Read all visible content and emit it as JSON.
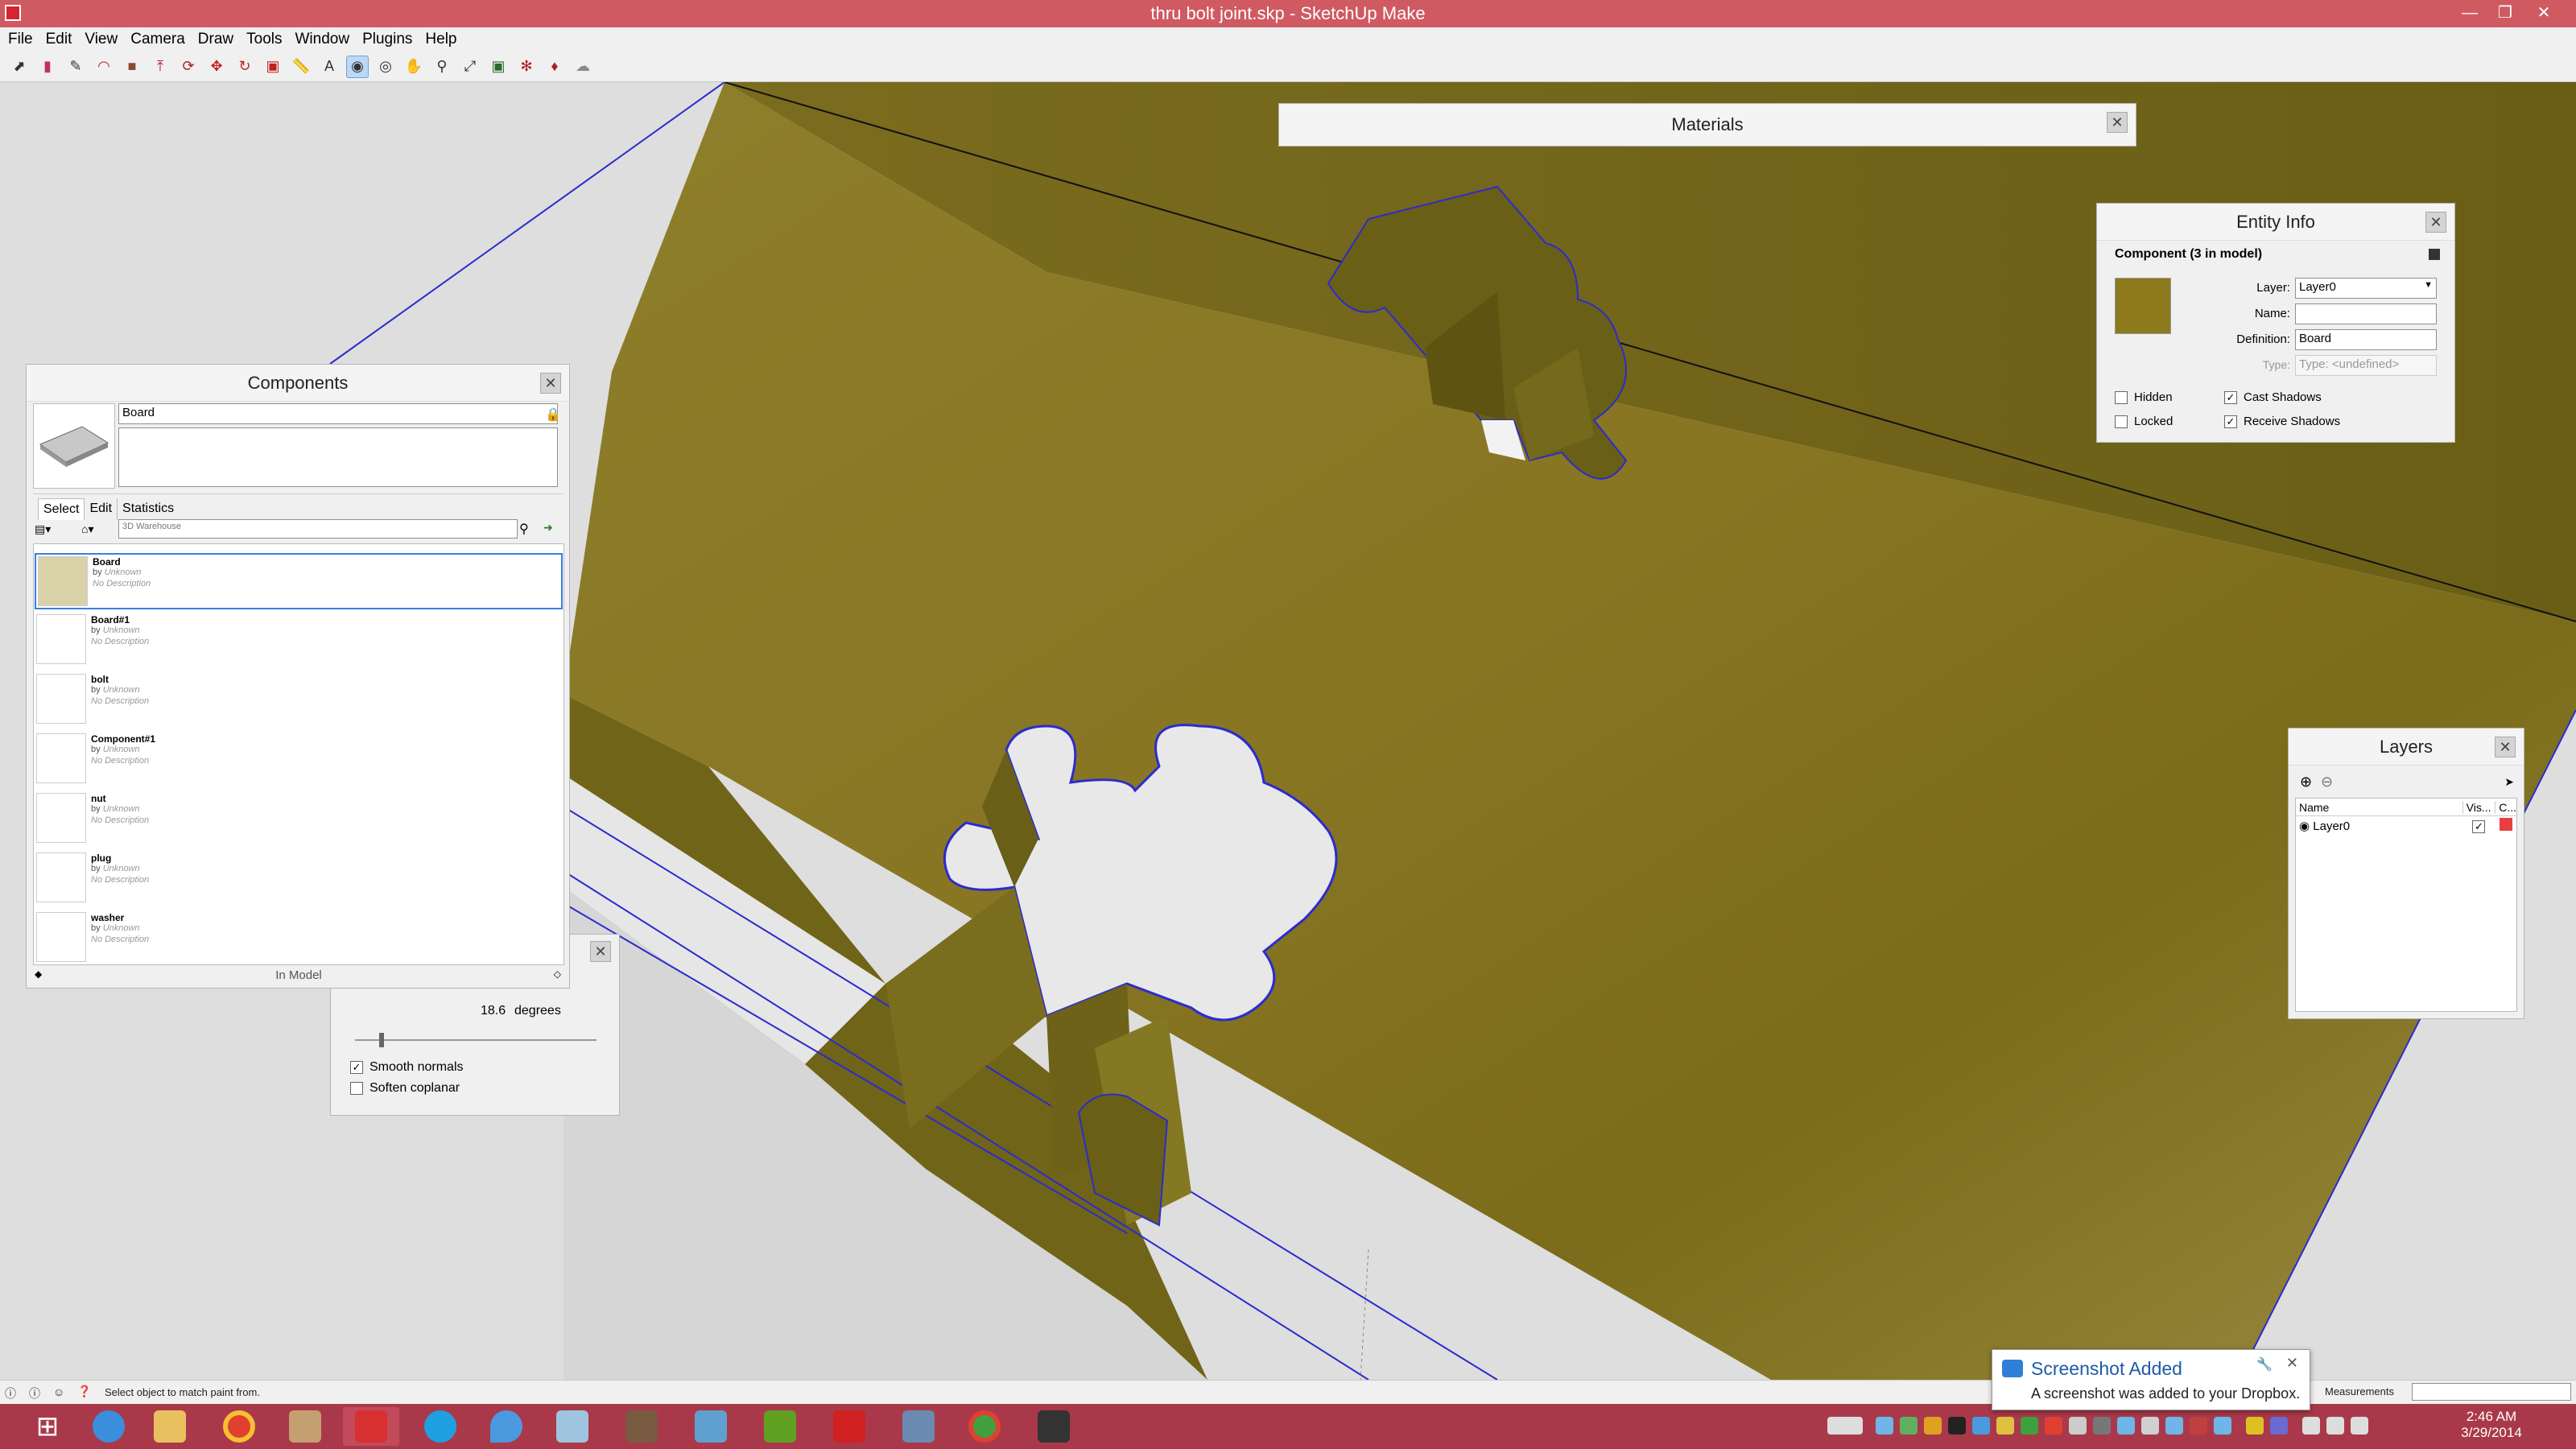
{
  "window": {
    "title": "thru bolt joint.skp - SketchUp Make",
    "controls": [
      "minimize",
      "restore",
      "close"
    ]
  },
  "menu": [
    "File",
    "Edit",
    "View",
    "Camera",
    "Draw",
    "Tools",
    "Window",
    "Plugins",
    "Help"
  ],
  "toolbar_icons": [
    "select-icon",
    "eraser-icon",
    "pencil-icon",
    "arc-icon",
    "rectangle-icon",
    "pushpull-icon",
    "followme-icon",
    "move-icon",
    "rotate-icon",
    "scale-icon",
    "tape-icon",
    "text-icon",
    "paint-icon",
    "orbit-icon",
    "pan-icon",
    "zoom-icon",
    "zoom-extents-icon",
    "warehouse-icon",
    "extension-icon",
    "ruby-icon",
    "sandbox-icon"
  ],
  "toolbar_active_index": 12,
  "materials": {
    "title": "Materials"
  },
  "entity_info": {
    "title": "Entity Info",
    "heading": "Component (3 in model)",
    "layer_label": "Layer:",
    "layer_value": "Layer0",
    "name_label": "Name:",
    "name_value": "",
    "definition_label": "Definition:",
    "definition_value": "Board",
    "type_label": "Type:",
    "type_value": "Type: <undefined>",
    "hidden_label": "Hidden",
    "hidden_checked": false,
    "locked_label": "Locked",
    "locked_checked": false,
    "cast_label": "Cast Shadows",
    "cast_checked": true,
    "receive_label": "Receive Shadows",
    "receive_checked": true,
    "swatch_color": "#8c7a1c"
  },
  "components": {
    "title": "Components",
    "name_value": "Board",
    "tabs": [
      "Select",
      "Edit",
      "Statistics"
    ],
    "search_value": "3D Warehouse",
    "footer": "In Model",
    "items": [
      {
        "name": "Board",
        "by": "by",
        "author": "Unknown",
        "desc": "No Description"
      },
      {
        "name": "Board#1",
        "by": "by",
        "author": "Unknown",
        "desc": "No Description"
      },
      {
        "name": "bolt",
        "by": "by",
        "author": "Unknown",
        "desc": "No Description"
      },
      {
        "name": "Component#1",
        "by": "by",
        "author": "Unknown",
        "desc": "No Description"
      },
      {
        "name": "nut",
        "by": "by",
        "author": "Unknown",
        "desc": "No Description"
      },
      {
        "name": "plug",
        "by": "by",
        "author": "Unknown",
        "desc": "No Description"
      },
      {
        "name": "washer",
        "by": "by",
        "author": "Unknown",
        "desc": "No Description"
      }
    ],
    "selected_index": 0
  },
  "soften_edges": {
    "angle_value": "18.6",
    "angle_unit": "degrees",
    "slider_value": 0.1,
    "smooth_label": "Smooth normals",
    "smooth_checked": true,
    "coplanar_label": "Soften coplanar",
    "coplanar_checked": false
  },
  "layers": {
    "title": "Layers",
    "col_name": "Name",
    "col_visible": "Vis...",
    "col_color": "C...",
    "rows": [
      {
        "name": "Layer0",
        "visible": true,
        "color": "#e84040"
      }
    ]
  },
  "status": {
    "hint": "Select object to match paint from.",
    "measurements_label": "Measurements"
  },
  "toast": {
    "title": "Screenshot Added",
    "body": "A screenshot was added to your Dropbox."
  },
  "clock": {
    "time": "2:46 AM",
    "date": "3/29/2014"
  },
  "taskbar_apps": [
    "start-icon",
    "ie-icon",
    "file-explorer-icon",
    "chrome-icon",
    "library-icon",
    "sketchup-icon",
    "skype-icon",
    "dropbox-icon",
    "notepad-icon",
    "books-icon",
    "network-icon",
    "nvidia-icon",
    "xmind-icon",
    "calculator-icon",
    "chrome-icon",
    "inkscape-icon"
  ],
  "colors": {
    "title_bar": "#cf5a62",
    "taskbar": "#a9394a",
    "wood_light": "#9a8a30",
    "wood_dark": "#6e6418",
    "edge_blue": "#2b2bd0"
  }
}
